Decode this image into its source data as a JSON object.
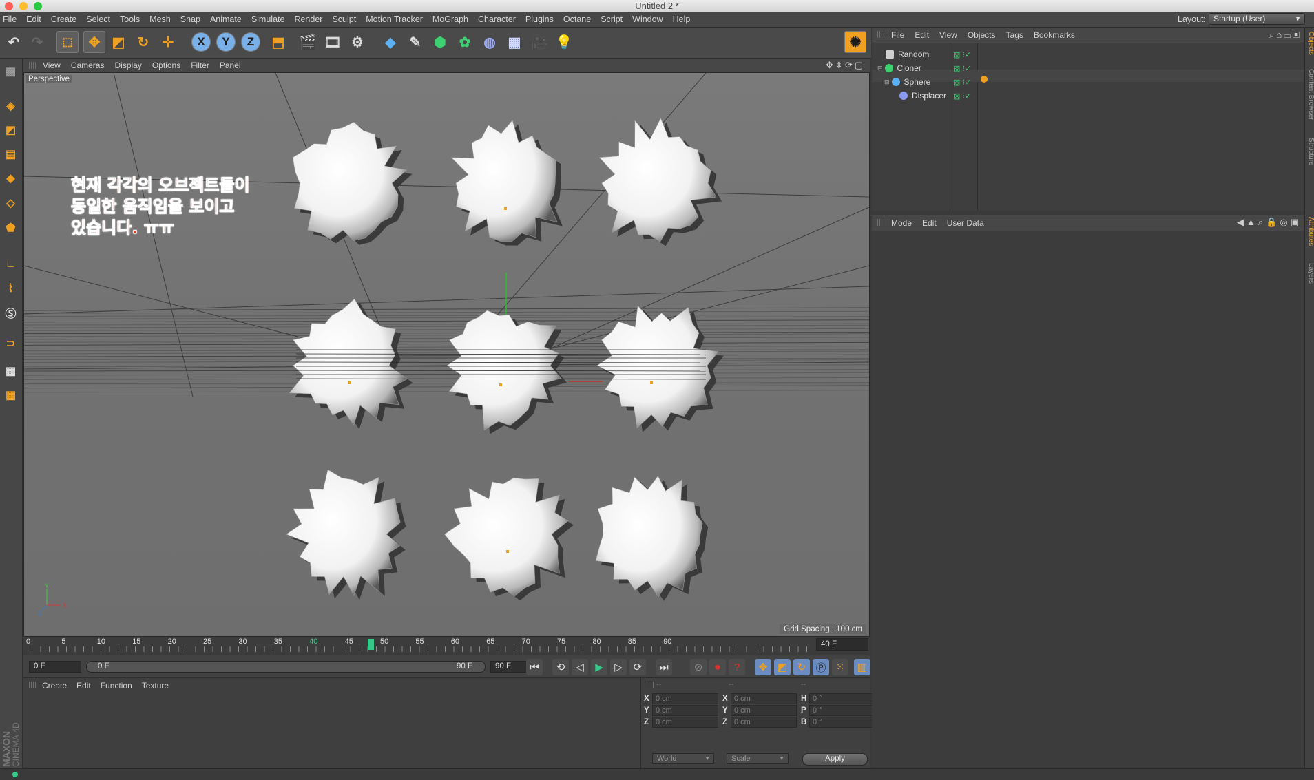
{
  "window": {
    "title": "Untitled 2 *"
  },
  "menubar": {
    "items": [
      "File",
      "Edit",
      "Create",
      "Select",
      "Tools",
      "Mesh",
      "Snap",
      "Animate",
      "Simulate",
      "Render",
      "Sculpt",
      "Motion Tracker",
      "MoGraph",
      "Character",
      "Plugins",
      "Octane",
      "Script",
      "Window",
      "Help"
    ],
    "layout_label": "Layout:",
    "layout_value": "Startup (User)"
  },
  "toolbar": {
    "axis_x": "X",
    "axis_y": "Y",
    "axis_z": "Z"
  },
  "viewport": {
    "menus": [
      "View",
      "Cameras",
      "Display",
      "Options",
      "Filter",
      "Panel"
    ],
    "camera_label": "Perspective",
    "grid_spacing": "Grid Spacing : 100 cm",
    "annotation_lines": [
      "현재 각각의 오브젝트들이",
      "동일한 움직임을 보이고",
      "있습니다. ㅠㅠ"
    ],
    "axis_labels": {
      "x": "X",
      "y": "Y",
      "z": "Z"
    }
  },
  "timeline": {
    "ticks": [
      "0",
      "5",
      "10",
      "15",
      "20",
      "25",
      "30",
      "35",
      "40",
      "45",
      "50",
      "55",
      "60",
      "65",
      "70",
      "75",
      "80",
      "85",
      "90"
    ],
    "current_frame_marker": "40",
    "end_field": "40 F"
  },
  "transport": {
    "start_field": "0 F",
    "range_start": "0 F",
    "range_end": "90 F",
    "end_field": "90 F"
  },
  "material_panel": {
    "menus": [
      "Create",
      "Edit",
      "Function",
      "Texture"
    ]
  },
  "coord_panel": {
    "headers": [
      "--",
      "--",
      "--"
    ],
    "rows": [
      {
        "l1": "X",
        "v1": "0 cm",
        "l2": "X",
        "v2": "0 cm",
        "l3": "H",
        "v3": "0 °"
      },
      {
        "l1": "Y",
        "v1": "0 cm",
        "l2": "Y",
        "v2": "0 cm",
        "l3": "P",
        "v3": "0 °"
      },
      {
        "l1": "Z",
        "v1": "0 cm",
        "l2": "Z",
        "v2": "0 cm",
        "l3": "B",
        "v3": "0 °"
      }
    ],
    "mode_world": "World",
    "mode_scale": "Scale",
    "apply_label": "Apply"
  },
  "objects_panel": {
    "menus": [
      "File",
      "Edit",
      "View",
      "Objects",
      "Tags",
      "Bookmarks"
    ],
    "items": [
      "Random",
      "Cloner",
      "Sphere",
      "Displacer"
    ]
  },
  "attributes_panel": {
    "menus": [
      "Mode",
      "Edit",
      "User Data"
    ]
  },
  "right_tabs": [
    "Objects",
    "Content Browser",
    "Structure",
    "Attributes",
    "Layers"
  ],
  "logo": {
    "line1": "MAXON",
    "line2": "CINEMA 4D"
  },
  "colors": {
    "accent_orange": "#f0a020",
    "annotation_red": "#e8341c",
    "playhead_green": "#37c98a"
  }
}
